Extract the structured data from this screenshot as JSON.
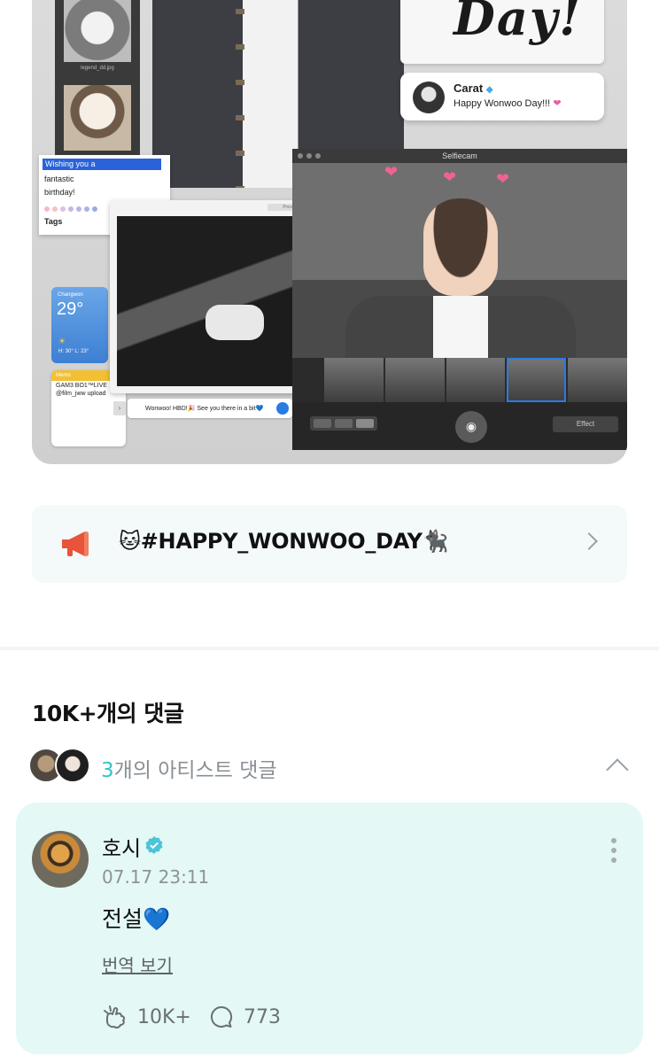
{
  "banner": {
    "dog_caption": "legend_dd.jpg",
    "day_text": "Day!",
    "carat_card": {
      "name": "Carat",
      "badge_icon": "diamond-icon",
      "message": "Happy Wonwoo Day!!!"
    },
    "tags_card": {
      "lines": [
        "Wishing you a",
        "fantastic",
        "birthday!"
      ],
      "label": "Tags"
    },
    "weather": {
      "city": "Changwon",
      "temp": "29°",
      "hilo": "H: 30° L: 23°"
    },
    "memo": {
      "title": "Memo",
      "lines": [
        "GAM3 BO1™LIVE",
        "@film_jww upload"
      ]
    },
    "photo_window": {
      "preview_label": "Preview"
    },
    "message_bar": {
      "text": "Wonwoo! HBD!🎉 See you there in a bit💙"
    },
    "selfiecam": {
      "title": "Selfiecam",
      "effect_label": "Effect"
    }
  },
  "notice": {
    "icon": "megaphone-icon",
    "text": "🐱#HAPPY_WONWOO_DAY🐈‍⬛"
  },
  "comments": {
    "count_label": "10K+개의 댓글",
    "artist_row": {
      "count": "3",
      "label": "개의 아티스트 댓글"
    },
    "items": [
      {
        "author": "호시",
        "verified": true,
        "date": "07.17 23:11",
        "body": "전설💙",
        "translate_label": "번역 보기",
        "likes": "10K+",
        "replies": "773"
      }
    ]
  },
  "colors": {
    "accent": "#35c2c1",
    "card_bg": "#e4f8f6",
    "notice_bg": "#f4f9f9",
    "megaphone": "#e8533a"
  }
}
